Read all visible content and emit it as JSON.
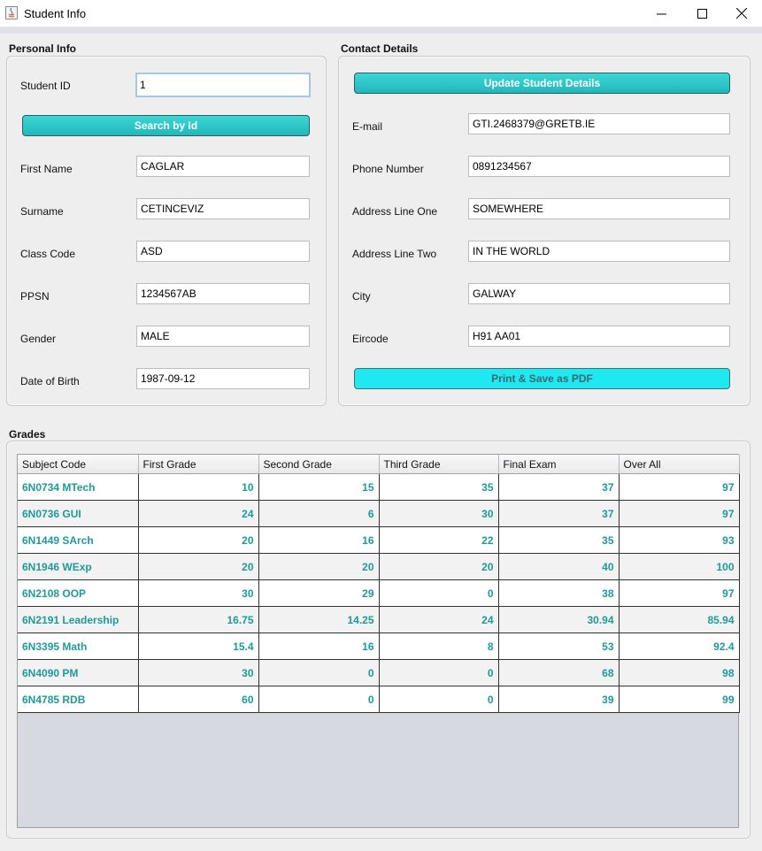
{
  "window": {
    "title": "Student Info"
  },
  "personal": {
    "section_title": "Personal Info",
    "student_id_label": "Student ID",
    "student_id_value": "1",
    "search_button": "Search by Id",
    "first_name_label": "First Name",
    "first_name_value": "CAGLAR",
    "surname_label": "Surname",
    "surname_value": "CETINCEVIZ",
    "class_code_label": "Class Code",
    "class_code_value": "ASD",
    "ppsn_label": "PPSN",
    "ppsn_value": "1234567AB",
    "gender_label": "Gender",
    "gender_value": "MALE",
    "dob_label": "Date of Birth",
    "dob_value": "1987-09-12"
  },
  "contact": {
    "section_title": "Contact Details",
    "update_button": "Update Student Details",
    "email_label": "E-mail",
    "email_value": "GTI.2468379@GRETB.IE",
    "phone_label": "Phone Number",
    "phone_value": "0891234567",
    "address1_label": "Address Line One",
    "address1_value": "SOMEWHERE",
    "address2_label": "Address Line Two",
    "address2_value": "IN THE WORLD",
    "city_label": "City",
    "city_value": "GALWAY",
    "eircode_label": "Eircode",
    "eircode_value": "H91 AA01",
    "pdf_button": "Print & Save as PDF"
  },
  "grades": {
    "section_title": "Grades",
    "columns": [
      "Subject Code",
      "First Grade",
      "Second Grade",
      "Third Grade",
      "Final Exam",
      "Over All"
    ],
    "rows": [
      [
        "6N0734 MTech",
        "10",
        "15",
        "35",
        "37",
        "97"
      ],
      [
        "6N0736 GUI",
        "24",
        "6",
        "30",
        "37",
        "97"
      ],
      [
        "6N1449 SArch",
        "20",
        "16",
        "22",
        "35",
        "93"
      ],
      [
        "6N1946 WExp",
        "20",
        "20",
        "20",
        "40",
        "100"
      ],
      [
        "6N2108 OOP",
        "30",
        "29",
        "0",
        "38",
        "97"
      ],
      [
        "6N2191 Leadership",
        "16.75",
        "14.25",
        "24",
        "30.94",
        "85.94"
      ],
      [
        "6N3395 Math",
        "15.4",
        "16",
        "8",
        "53",
        "92.4"
      ],
      [
        "6N4090 PM",
        "30",
        "0",
        "0",
        "68",
        "98"
      ],
      [
        "6N4785 RDB",
        "60",
        "0",
        "0",
        "39",
        "99"
      ]
    ]
  },
  "colors": {
    "accent_teal": "#22b8bb",
    "grade_text": "#1e9a9a",
    "pdf_button": "#1ee8f0"
  }
}
